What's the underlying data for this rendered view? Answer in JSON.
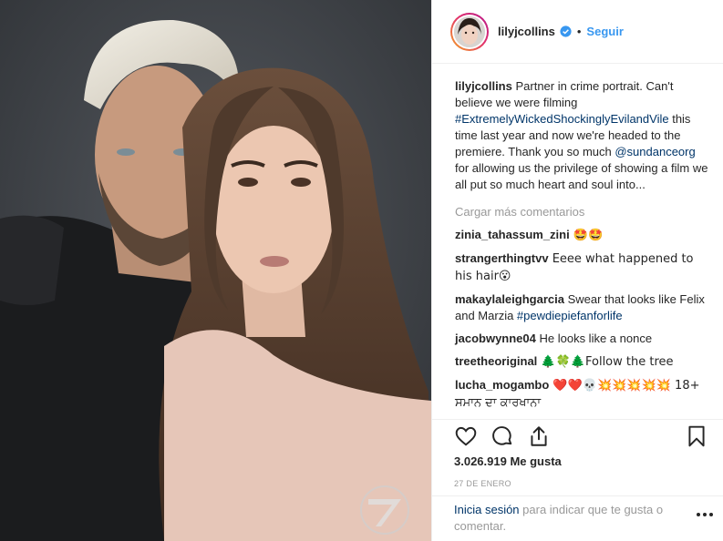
{
  "post": {
    "username": "lilyjcollins",
    "separator": "•",
    "follow_label": "Seguir",
    "caption": {
      "username": "lilyjcollins",
      "text_1": " Partner in crime portrait. Can't believe we were filming ",
      "hashtag": "#ExtremelyWickedShockinglyEvilandVile",
      "text_2": " this time last year and now we're headed to the premiere. Thank you so much ",
      "mention": "@sundanceorg",
      "text_3": " for allowing us the privilege of showing a film we all put so much heart and soul into..."
    },
    "load_more_label": "Cargar más comentarios",
    "comments": [
      {
        "user": "zinia_tahassum_zini",
        "text": " 🤩🤩",
        "link": "",
        "text_after": ""
      },
      {
        "user": "strangerthingtvv",
        "text": " Eeee what happened to his hair😮",
        "link": "",
        "text_after": ""
      },
      {
        "user": "makaylaleighgarcia",
        "text": " Swear that looks like Felix and Marzia ",
        "link": "#pewdiepiefanforlife",
        "text_after": ""
      },
      {
        "user": "jacobwynne04",
        "text": " He looks like a nonce",
        "link": "",
        "text_after": ""
      },
      {
        "user": "treetheoriginal",
        "text": " 🌲🍀🌲Follow the tree",
        "link": "",
        "text_after": ""
      },
      {
        "user": "lucha_mogambo",
        "text": " ❤️❤️💀💥💥💥💥💥 18+ ਸਮਾਨ ਦਾ ਕਾਰਖਾਨਾ",
        "link": "",
        "text_after": ""
      }
    ],
    "likes_label": "3.026.919 Me gusta",
    "date_label": "27 DE ENERO",
    "login_link": "Inicia sesión",
    "login_text": " para indicar que te gusta o comentar.",
    "icons": [
      "heart-icon",
      "comment-icon",
      "share-icon",
      "bookmark-icon",
      "more-options-icon",
      "verified-badge-icon"
    ],
    "colors": {
      "link": "#003569",
      "follow": "#3897f0",
      "verified": "#3897f0",
      "muted": "#999999"
    }
  }
}
